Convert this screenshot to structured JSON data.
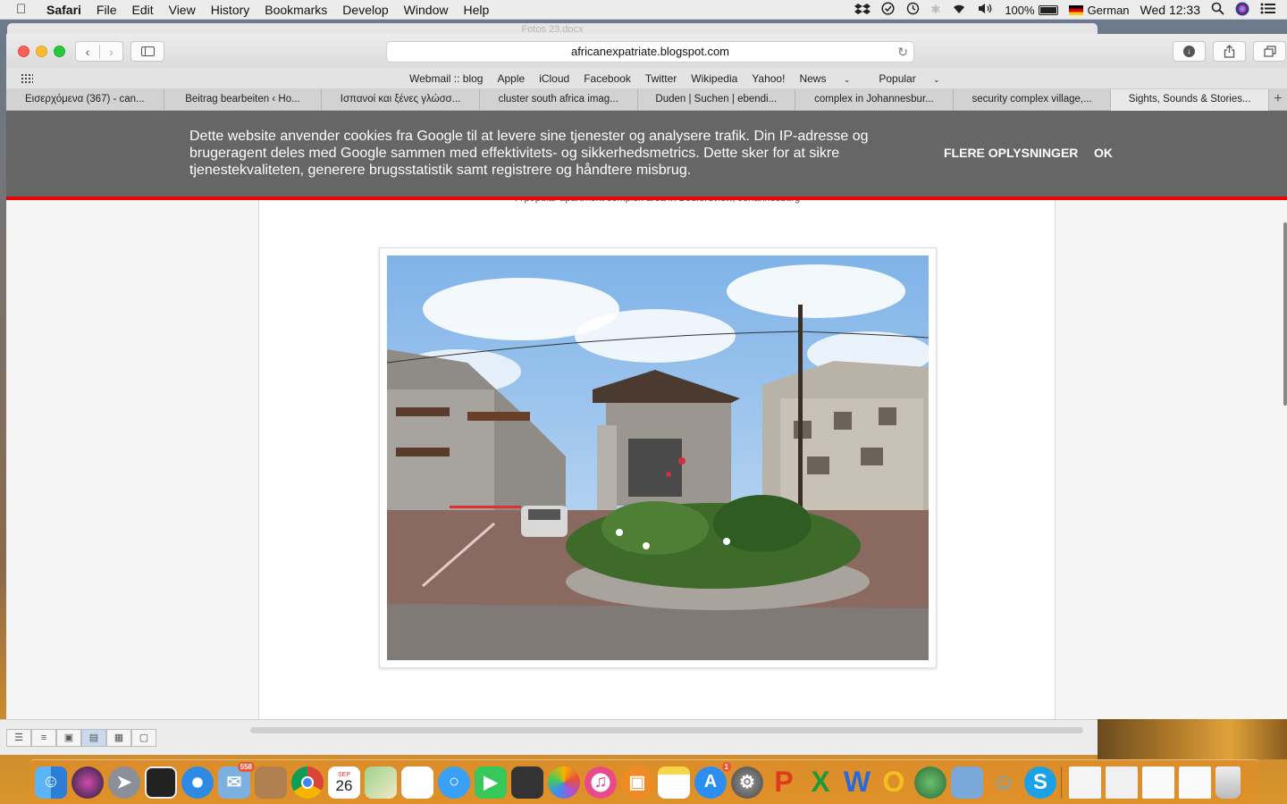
{
  "menubar": {
    "app": "Safari",
    "items": [
      "File",
      "Edit",
      "View",
      "History",
      "Bookmarks",
      "Develop",
      "Window",
      "Help"
    ],
    "battery": "100%",
    "input_source": "German",
    "clock": "Wed 12:33"
  },
  "background_window": {
    "title": "Fotos 23.docx"
  },
  "toolbar": {
    "url": "africanexpatriate.blogspot.com"
  },
  "favorites": [
    "Webmail :: blog",
    "Apple",
    "iCloud",
    "Facebook",
    "Twitter",
    "Wikipedia",
    "Yahoo!",
    "News",
    "Popular"
  ],
  "tabs": [
    "Εισερχόμενα (367) - can...",
    "Beitrag bearbeiten ‹ Ho...",
    "Ισπανοί και ξένες γλώσσ...",
    "cluster south africa imag...",
    "Duden | Suchen | ebendi...",
    "complex in Johannesbur...",
    "security complex village,...",
    "Sights, Sounds & Stories..."
  ],
  "cookie": {
    "text": "Dette website anvender cookies fra Google til at levere sine tjenester og analysere trafik. Din IP-adresse og brugeragent deles med Google sammen med effektivitets- og sikkerhedsmetrics. Dette sker for at sikre tjenestekvaliteten, generere brugsstatistik samt registrere og håndtere misbrug.",
    "more": "FLERE OPLYSNINGER",
    "ok": "OK"
  },
  "post": {
    "caption": "A popular apartment complex area in Bedfordview, Johannesburg"
  },
  "dock": {
    "calendar_month": "SEP",
    "calendar_day": "26",
    "mail_badge": "558",
    "appstore_badge": "1"
  },
  "colors": {
    "cookie_bg": "#666666",
    "cookie_border": "#ee0000"
  }
}
